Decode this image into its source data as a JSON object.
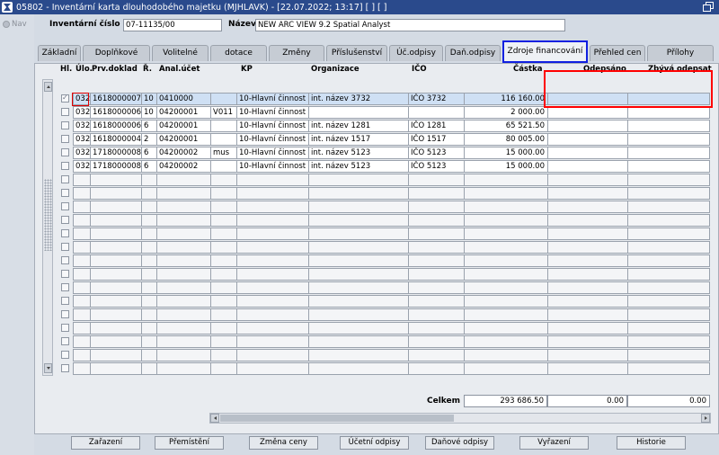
{
  "window": {
    "title": "05802 - Inventární karta dlouhodobého majetku (MJHLAVK) - [22.07.2022; 13:17] [ ] [ ]"
  },
  "nav": {
    "label": "Nav"
  },
  "header": {
    "inv_label": "Inventární číslo",
    "inv_value": "07-11135/00",
    "name_label": "Název",
    "name_value": "NEW ARC VIEW 9.2 Spatial Analyst"
  },
  "tabs": [
    {
      "label": "Základní"
    },
    {
      "label": "Doplňkové"
    },
    {
      "label": "Volitelné"
    },
    {
      "label": "dotace"
    },
    {
      "label": "Změny"
    },
    {
      "label": "Příslušenství"
    },
    {
      "label": "Úč.odpisy"
    },
    {
      "label": "Daň.odpisy"
    },
    {
      "label": "Zdroje financování",
      "active": true
    },
    {
      "label": "Přehled cen"
    },
    {
      "label": "Přílohy"
    }
  ],
  "table": {
    "columns": {
      "hl": "Hl.",
      "ulo": "Úlo.",
      "doklad": "Prv.doklad",
      "r": "Ř.",
      "anal": "Anal.účet",
      "kp": "KP",
      "org": "Organizace",
      "ico": "IČO",
      "castka": "Částka",
      "odepsano": "Odepsáno",
      "zbyva": "Zbývá odepsat"
    },
    "rows": [
      {
        "hl": true,
        "ulo": "032",
        "doklad": "1618000007",
        "r": "10",
        "anal": "0410000",
        "x": "",
        "kp": "10-Hlavní činnost",
        "org": "int. název 3732",
        "ico": "IČO 3732",
        "castka": "116 160.00",
        "odepsano": "",
        "zbyva": ""
      },
      {
        "hl": false,
        "ulo": "032",
        "doklad": "1618000006",
        "r": "10",
        "anal": "04200001",
        "x": "V011",
        "kp": "10-Hlavní činnost",
        "org": "",
        "ico": "",
        "castka": "2 000.00",
        "odepsano": "",
        "zbyva": ""
      },
      {
        "hl": false,
        "ulo": "032",
        "doklad": "1618000006",
        "r": "6",
        "anal": "04200001",
        "x": "",
        "kp": "10-Hlavní činnost",
        "org": "int. název 1281",
        "ico": "IČO 1281",
        "castka": "65 521.50",
        "odepsano": "",
        "zbyva": ""
      },
      {
        "hl": false,
        "ulo": "032",
        "doklad": "1618000004",
        "r": "2",
        "anal": "04200001",
        "x": "",
        "kp": "10-Hlavní činnost",
        "org": "int. název 1517",
        "ico": "IČO 1517",
        "castka": "80 005.00",
        "odepsano": "",
        "zbyva": ""
      },
      {
        "hl": false,
        "ulo": "032",
        "doklad": "1718000008",
        "r": "6",
        "anal": "04200002",
        "x": "mus",
        "kp": "10-Hlavní činnost",
        "org": "int. název 5123",
        "ico": "IČO 5123",
        "castka": "15 000.00",
        "odepsano": "",
        "zbyva": ""
      },
      {
        "hl": false,
        "ulo": "032",
        "doklad": "1718000008",
        "r": "6",
        "anal": "04200002",
        "x": "",
        "kp": "10-Hlavní činnost",
        "org": "int. název 5123",
        "ico": "IČO 5123",
        "castka": "15 000.00",
        "odepsano": "",
        "zbyva": ""
      }
    ],
    "empty_row_count": 15
  },
  "totals": {
    "label": "Celkem",
    "castka": "293 686.50",
    "odepsano": "0.00",
    "zbyva": "0.00"
  },
  "buttons": [
    {
      "label": "Zařazení"
    },
    {
      "label": "Přemístění"
    },
    {
      "label": "Změna ceny"
    },
    {
      "label": "Účetní odpisy"
    },
    {
      "label": "Daňové odpisy"
    },
    {
      "label": "Vyřazení"
    },
    {
      "label": "Historie"
    }
  ],
  "colors": {
    "highlight_tab": "#1020e0",
    "annotation": "#ff0000",
    "titlebar": "#2a4a8c"
  }
}
